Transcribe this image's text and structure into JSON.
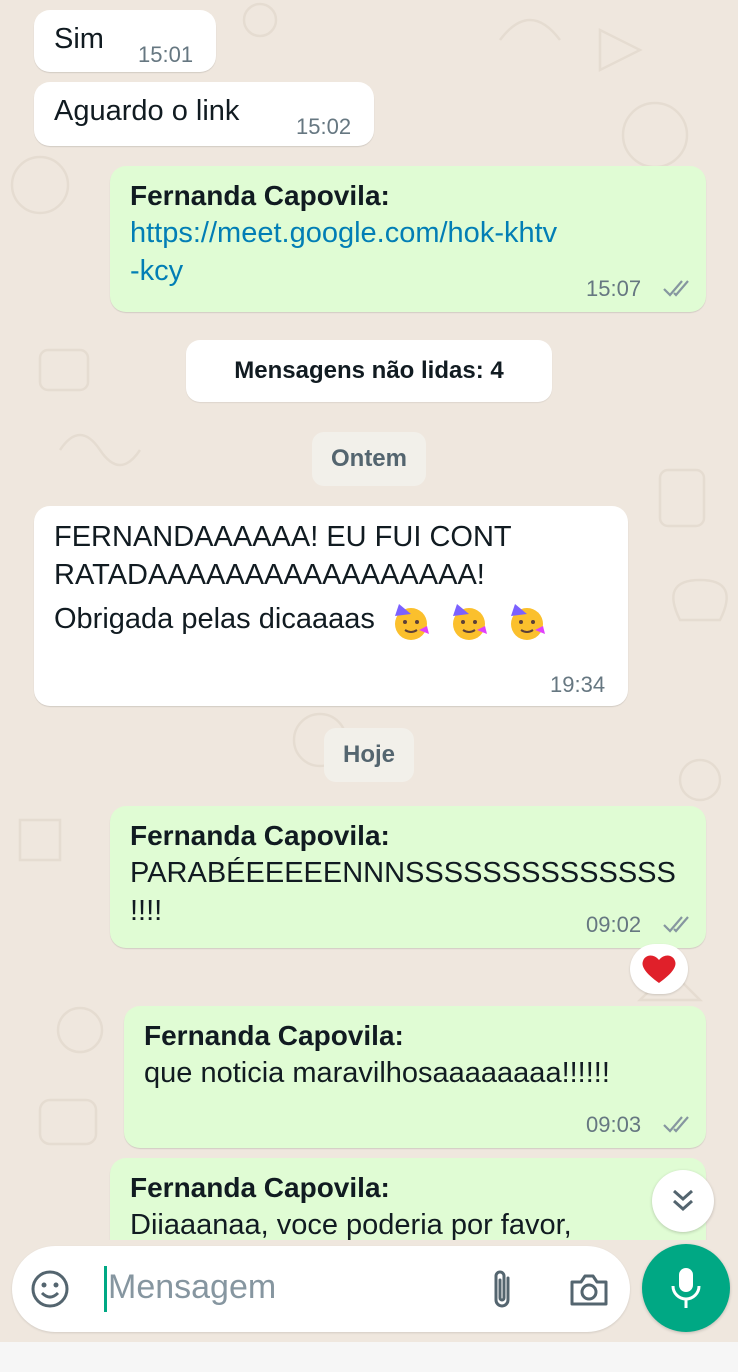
{
  "messages": [
    {
      "text": "Sim",
      "time": "15:01"
    },
    {
      "text": "Aguardo o link",
      "time": "15:02"
    },
    {
      "sender": "Fernanda Capovila:",
      "link_line1": "https://meet.google.com/hok-khtv",
      "link_line2": "-kcy",
      "time": "15:07"
    },
    {
      "line1": "FERNANDAAAAAA! EU FUI CONT",
      "line2": "RATADAAAAAAAAAAAAAAAAA!",
      "line3": "Obrigada pelas dicaaaas",
      "time": "19:34"
    },
    {
      "sender": "Fernanda Capovila:",
      "line1": "PARABÉEEEEENNNSSSSSSSSSSSSSS",
      "line2": "!!!!",
      "time": "09:02"
    },
    {
      "sender": "Fernanda Capovila:",
      "text": "que noticia maravilhosaaaaaaaa!!!!!!",
      "time": "09:03"
    },
    {
      "sender": "Fernanda Capovila:",
      "text": "Diiaaanaa, voce poderia por favor,"
    }
  ],
  "unread_banner": "Mensagens não lidas: 4",
  "date_separators": {
    "yesterday": "Ontem",
    "today": "Hoje"
  },
  "reaction": "heart",
  "composer": {
    "placeholder": "Mensagem"
  },
  "icons": [
    "emoji-icon",
    "attach-icon",
    "camera-icon",
    "mic-icon",
    "double-chevron-down-icon",
    "read-ticks-icon",
    "party-face-emoji",
    "heart-emoji"
  ],
  "colors": {
    "outgoing": "#e0fcd4",
    "incoming": "#ffffff",
    "accent": "#00a884",
    "link": "#027eb5",
    "background": "#efe7de"
  }
}
